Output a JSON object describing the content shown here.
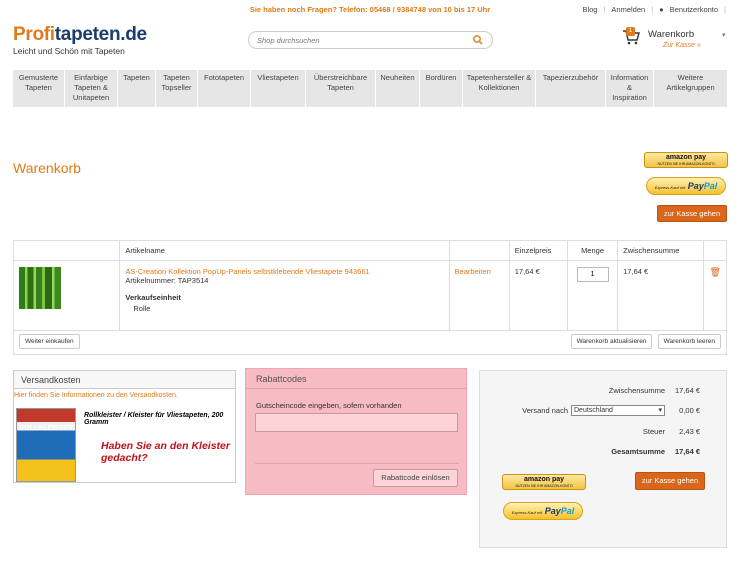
{
  "topbar": {
    "message": "Sie haben noch Fragen? Telefon: 05468 / 9384748 von 10 bis 17 Uhr",
    "blog": "Blog",
    "login": "Anmelden",
    "account": "Benutzerkonto"
  },
  "brand": {
    "logo_part1": "Profi",
    "logo_part2": "tapeten.de",
    "tagline": "Leicht und Schön mit Tapeten",
    "accent": "#e07b1a"
  },
  "search": {
    "placeholder": "Shop durchsuchen"
  },
  "minicart": {
    "title": "Warenkorb",
    "link": "Zur Kasse »",
    "count": "1"
  },
  "nav": {
    "items": [
      {
        "label": "Gemusterte Tapeten"
      },
      {
        "label": "Einfarbige Tapeten & Unitapeten"
      },
      {
        "label": "Tapeten"
      },
      {
        "label": "Tapeten Topseller"
      },
      {
        "label": "Fototapeten"
      },
      {
        "label": "Vliestapeten"
      },
      {
        "label": "Überstreichbare Tapeten"
      },
      {
        "label": "Neuheiten"
      },
      {
        "label": "Bordüren"
      },
      {
        "label": "Tapetenhersteller & Kollektionen"
      },
      {
        "label": "Tapezierzubehör"
      },
      {
        "label": "Information & Inspiration"
      },
      {
        "label": "Weitere Artikelgruppen"
      }
    ]
  },
  "page": {
    "title": "Warenkorb"
  },
  "payment": {
    "amazon_label": "amazon pay",
    "amazon_sub": "NUTZEN SIE IHR AMAZON-KONTO",
    "paypal_express": "Express-Kauf mit",
    "paypal_pay": "Pay",
    "paypal_pal": "Pal",
    "checkout": "zur Kasse gehen"
  },
  "table": {
    "headers": {
      "article": "Artikelname",
      "unit_price": "Einzelpreis",
      "qty": "Menge",
      "subtotal": "Zwischensumme"
    },
    "item": {
      "name": "AS-Creation Kollektion PopUp-Panels selbstklebende Vliestapete 943661",
      "sku": "Artikelnummer: TAP3514",
      "unit_label": "Verkaufseinheit",
      "unit_value": "Rolle",
      "edit": "Bearbeiten",
      "price": "17,64 €",
      "qty": "1",
      "subtotal": "17,64 €"
    },
    "continue": "Weiter einkaufen",
    "update": "Warenkorb aktualisieren",
    "empty": "Warenkorb leeren"
  },
  "shipping": {
    "title": "Versandkosten",
    "note": "Hier finden Sie Informationen zu den Versandkosten.",
    "product_pack": "ROLLKLEISTER",
    "product_title": "Rollkleister / Kleister für Vliestapeten, 200 Gramm",
    "question": "Haben Sie an den Kleister gedacht?"
  },
  "coupon": {
    "title": "Rabattcodes",
    "label": "Gutscheincode eingeben, sofern vorhanden",
    "button": "Rabattcode einlösen"
  },
  "summary": {
    "subtotal_label": "Zwischensumme",
    "subtotal": "17,64 €",
    "shipping_label": "Versand nach",
    "country": "Deutschland",
    "shipping": "0,00 €",
    "tax_label": "Steuer",
    "tax": "2,43 €",
    "total_label": "Gesamtsumme",
    "total": "17,64 €"
  }
}
